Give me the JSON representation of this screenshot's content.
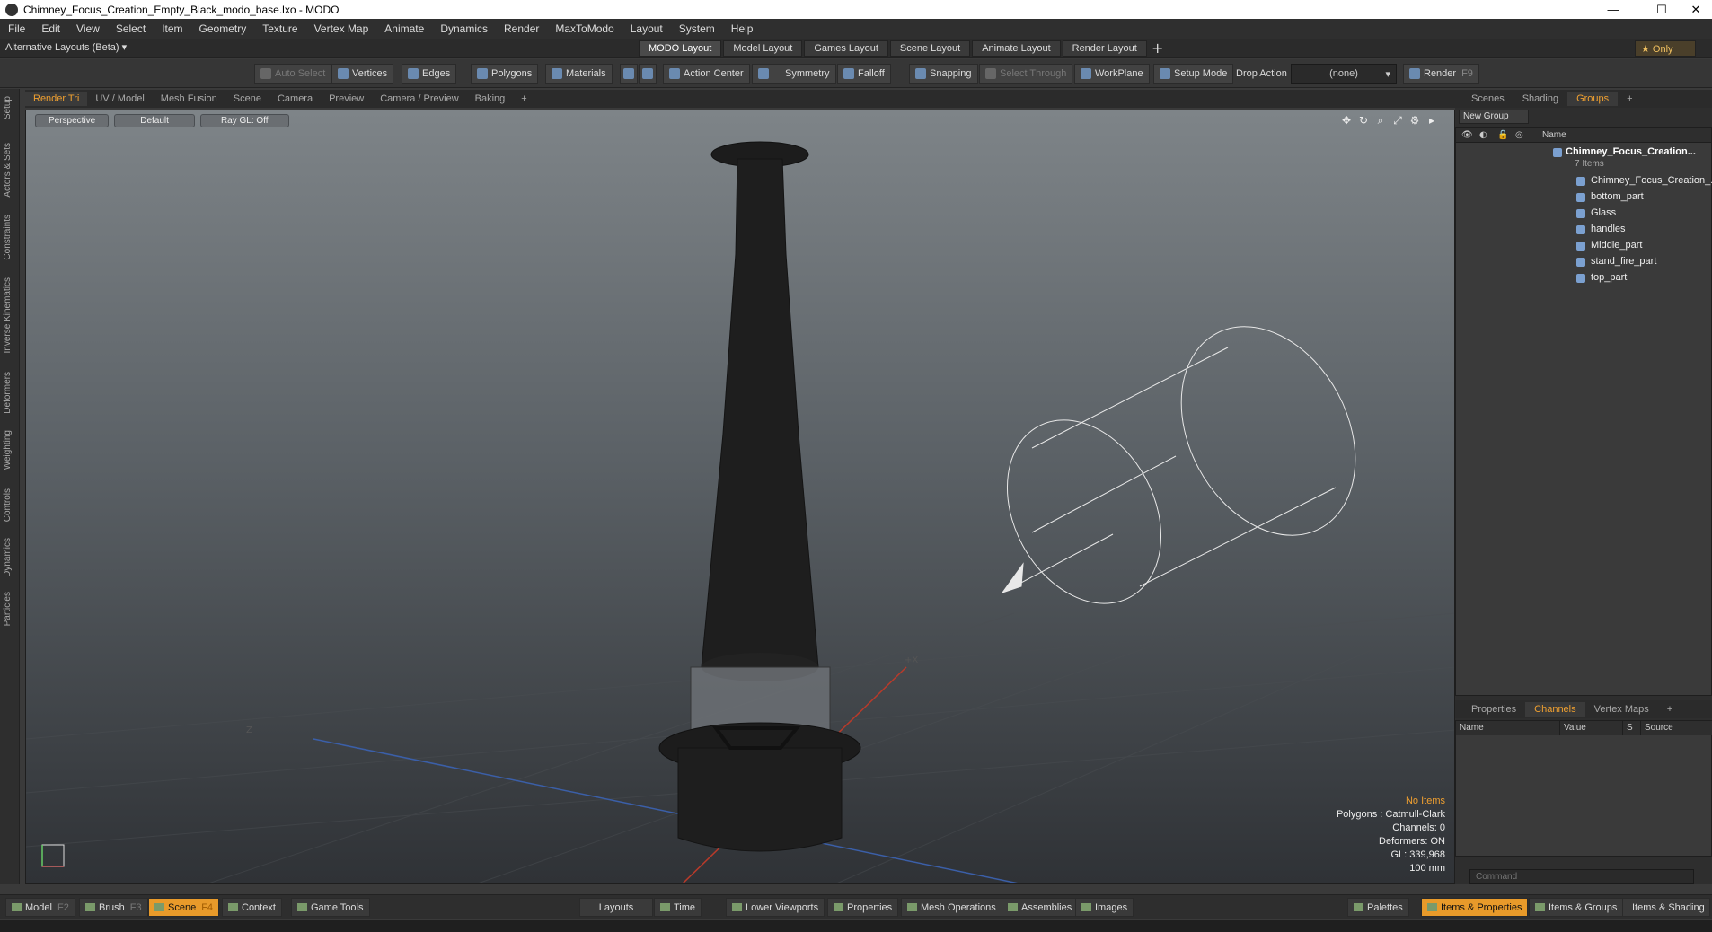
{
  "window": {
    "title": "Chimney_Focus_Creation_Empty_Black_modo_base.lxo - MODO",
    "min": "—",
    "max": "☐",
    "close": "✕"
  },
  "menu": [
    "File",
    "Edit",
    "View",
    "Select",
    "Item",
    "Geometry",
    "Texture",
    "Vertex Map",
    "Animate",
    "Dynamics",
    "Render",
    "MaxToModo",
    "Layout",
    "System",
    "Help"
  ],
  "layout_bar": {
    "alt_layouts": "Alternative Layouts (Beta) ▾",
    "tabs": [
      "MODO Layout",
      "Model Layout",
      "Games Layout",
      "Scene Layout",
      "Animate Layout",
      "Render Layout"
    ],
    "plus": "+",
    "only": "★  Only"
  },
  "toolbar": {
    "auto_select": "Auto Select",
    "vertices": "Vertices",
    "edges": "Edges",
    "polygons": "Polygons",
    "materials": "Materials",
    "action_center": "Action Center",
    "symmetry": "Symmetry",
    "falloff": "Falloff",
    "snapping": "Snapping",
    "select_through": "Select Through",
    "workplane": "WorkPlane",
    "setup_mode": "Setup Mode",
    "drop_action": "Drop Action",
    "drop_value": "(none)",
    "render": "Render",
    "render_key": "F9"
  },
  "left_strip": [
    "Setup",
    "Actors & Sets",
    "Constraints",
    "Inverse Kinematics",
    "Deformers",
    "Weighting",
    "Controls",
    "Dynamics",
    "Particles"
  ],
  "viewport_tabs": [
    "Render Tri",
    "UV / Model",
    "Mesh Fusion",
    "Scene",
    "Camera",
    "Preview",
    "Camera / Preview",
    "Baking",
    "+"
  ],
  "viewport": {
    "view": "Perspective",
    "shading": "Default",
    "raygl": "Ray GL: Off",
    "info": {
      "no_items": "No Items",
      "polygons": "Polygons : Catmull-Clark",
      "channels": "Channels: 0",
      "deformers": "Deformers: ON",
      "gl": "GL: 339,968",
      "scale": "100 mm"
    }
  },
  "right_tabs": [
    "Scenes",
    "Shading",
    "Groups",
    "+"
  ],
  "groups": {
    "new_group": "New Group",
    "col_name": "Name",
    "root": "Chimney_Focus_Creation...",
    "root_count": "7 Items",
    "items": [
      "Chimney_Focus_Creation_...",
      "bottom_part",
      "Glass",
      "handles",
      "Middle_part",
      "stand_fire_part",
      "top_part"
    ]
  },
  "channel_tabs": [
    "Properties",
    "Channels",
    "Vertex Maps",
    "+"
  ],
  "channels": {
    "name": "Name",
    "value": "Value",
    "s": "S",
    "source": "Source"
  },
  "command_placeholder": "Command",
  "bottom_bar": {
    "model": "Model",
    "model_key": "F2",
    "brush": "Brush",
    "brush_key": "F3",
    "scene": "Scene",
    "scene_key": "F4",
    "context": "Context",
    "game_tools": "Game Tools",
    "layouts": "Layouts",
    "time": "Time",
    "lower_viewports": "Lower Viewports",
    "properties": "Properties",
    "mesh_operations": "Mesh Operations",
    "assemblies": "Assemblies",
    "images": "Images",
    "palettes": "Palettes",
    "items_properties": "Items & Properties",
    "items_groups": "Items & Groups",
    "items_shading": "Items & Shading"
  },
  "colors": {
    "accent": "#f0a030",
    "active_tab": "#e89a2a"
  }
}
